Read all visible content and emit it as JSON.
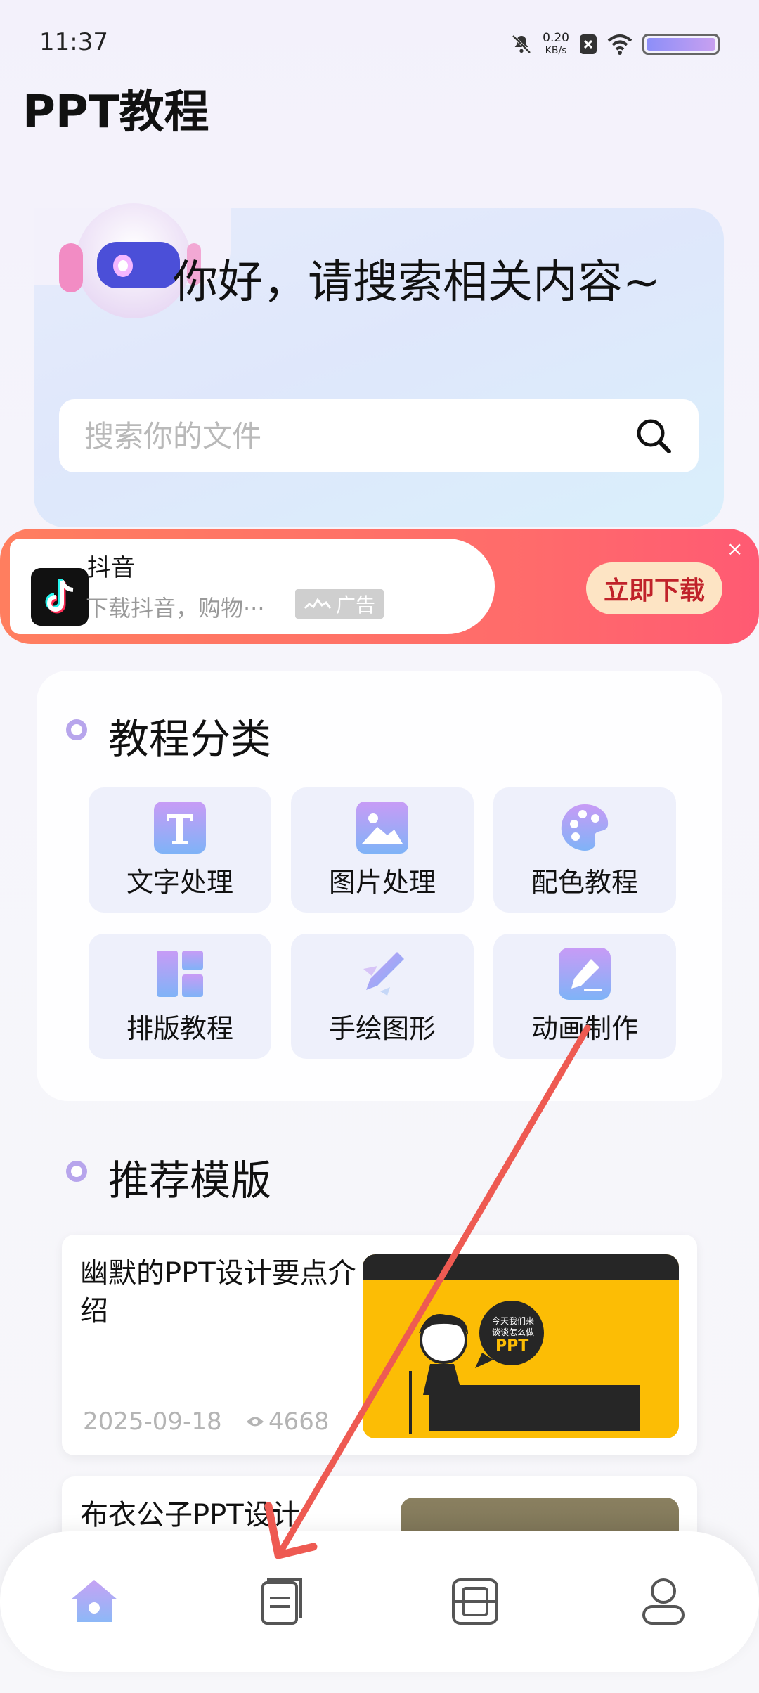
{
  "status_bar": {
    "time": "11:37",
    "net_speed_value": "0.20",
    "net_speed_unit": "KB/s",
    "icons": [
      "mute-icon",
      "net-speed",
      "sim-off-icon",
      "wifi-icon",
      "battery-icon"
    ]
  },
  "app": {
    "title": "PPT教程"
  },
  "hero": {
    "greeting": "你好，请搜索相关内容~",
    "search_placeholder": "搜索你的文件"
  },
  "ad": {
    "app_name": "抖音",
    "description": "下载抖音，购物···",
    "tag": "广告",
    "cta": "立即下载",
    "close": "×",
    "colors": {
      "banner": "#ff6b6b",
      "cta_bg": "#fde4c4",
      "cta_text": "#c0222a"
    }
  },
  "categories": {
    "title": "教程分类",
    "items": [
      {
        "label": "文字处理",
        "icon": "text-icon"
      },
      {
        "label": "图片处理",
        "icon": "image-icon"
      },
      {
        "label": "配色教程",
        "icon": "palette-icon"
      },
      {
        "label": "排版教程",
        "icon": "layout-icon"
      },
      {
        "label": "手绘图形",
        "icon": "pen-icon"
      },
      {
        "label": "动画制作",
        "icon": "edit-icon"
      }
    ]
  },
  "recommended": {
    "title": "推荐模版",
    "items": [
      {
        "title": "幽默的PPT设计要点介绍",
        "date": "2025-09-18",
        "views": "4668",
        "thumb_text_1": "今天我们来",
        "thumb_text_2": "谈谈怎么做",
        "thumb_badge": "PPT"
      },
      {
        "title": "布衣公子PPT设计"
      }
    ]
  },
  "bottom_nav": {
    "items": [
      {
        "name": "home",
        "icon": "home-icon",
        "active": true
      },
      {
        "name": "documents",
        "icon": "document-icon",
        "active": false
      },
      {
        "name": "scan",
        "icon": "scan-icon",
        "active": false
      },
      {
        "name": "profile",
        "icon": "user-icon",
        "active": false
      }
    ]
  },
  "colors": {
    "accent": "#8b7cf6",
    "dot": "#b7a5ec",
    "annotation_arrow": "#ee5a52"
  }
}
